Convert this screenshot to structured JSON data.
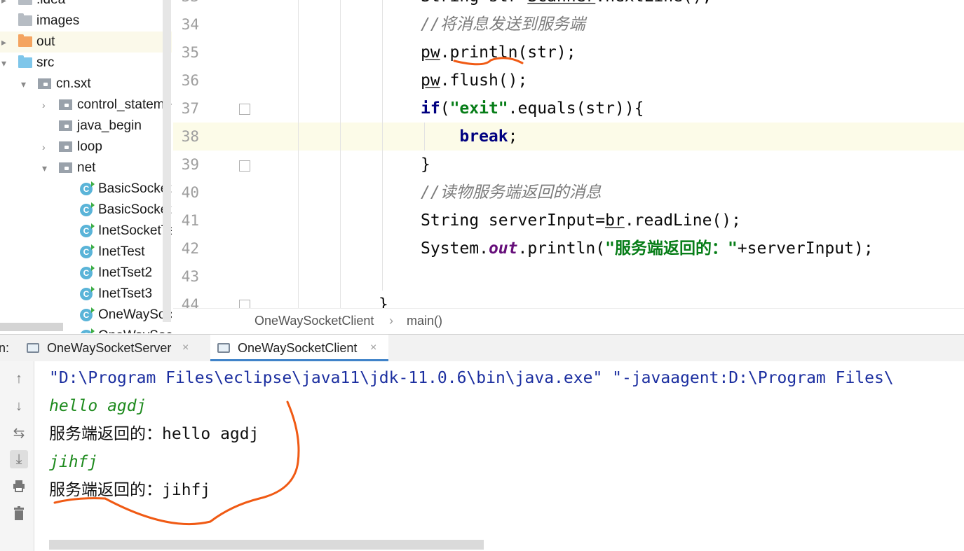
{
  "tree": {
    "items": [
      {
        "label": ".idea",
        "indent": 0,
        "icon": "folder",
        "arrow": "▸"
      },
      {
        "label": "images",
        "indent": 0,
        "icon": "folder",
        "arrow": ""
      },
      {
        "label": "out",
        "indent": 0,
        "icon": "folder-orange",
        "arrow": "▸"
      },
      {
        "label": "src",
        "indent": 0,
        "icon": "folder-blue",
        "arrow": "▾"
      },
      {
        "label": "cn.sxt",
        "indent": 1,
        "icon": "package",
        "arrow": "▾"
      },
      {
        "label": "control_statement",
        "indent": 2,
        "icon": "package",
        "arrow": "›"
      },
      {
        "label": "java_begin",
        "indent": 2,
        "icon": "package",
        "arrow": ""
      },
      {
        "label": "loop",
        "indent": 2,
        "icon": "package",
        "arrow": "›"
      },
      {
        "label": "net",
        "indent": 2,
        "icon": "package",
        "arrow": "▾"
      },
      {
        "label": "BasicSocketClient",
        "indent": 3,
        "icon": "class",
        "arrow": ""
      },
      {
        "label": "BasicSocketServer",
        "indent": 3,
        "icon": "class",
        "arrow": ""
      },
      {
        "label": "InetSocketTest",
        "indent": 3,
        "icon": "class",
        "arrow": ""
      },
      {
        "label": "InetTest",
        "indent": 3,
        "icon": "class",
        "arrow": ""
      },
      {
        "label": "InetTset2",
        "indent": 3,
        "icon": "class",
        "arrow": ""
      },
      {
        "label": "InetTset3",
        "indent": 3,
        "icon": "class",
        "arrow": ""
      },
      {
        "label": "OneWaySocketClient",
        "indent": 3,
        "icon": "class",
        "arrow": ""
      },
      {
        "label": "OneWaySocketServer",
        "indent": 3,
        "icon": "class",
        "arrow": ""
      }
    ]
  },
  "editor": {
    "lines": [
      {
        "num": "33",
        "parts": [
          [
            "plain",
            "String str="
          ],
          [
            "ul",
            "Scanner"
          ],
          [
            "plain",
            ".nextLine();"
          ]
        ]
      },
      {
        "num": "34",
        "parts": [
          [
            "cmt",
            "//将消息发送到服务端"
          ]
        ]
      },
      {
        "num": "35",
        "parts": [
          [
            "ul",
            "pw"
          ],
          [
            "plain",
            ".println(str);"
          ]
        ]
      },
      {
        "num": "36",
        "parts": [
          [
            "ul",
            "pw"
          ],
          [
            "plain",
            ".flush();"
          ]
        ]
      },
      {
        "num": "37",
        "parts": [
          [
            "kw",
            "if"
          ],
          [
            "plain",
            "("
          ],
          [
            "str",
            "\"exit\""
          ],
          [
            "plain",
            ".equals(str)){"
          ]
        ]
      },
      {
        "num": "38",
        "parts": [
          [
            "plain",
            "    "
          ],
          [
            "kw",
            "break"
          ],
          [
            "plain",
            ";"
          ]
        ]
      },
      {
        "num": "39",
        "parts": [
          [
            "plain",
            "}"
          ]
        ]
      },
      {
        "num": "40",
        "parts": [
          [
            "cmt",
            "//读物服务端返回的消息"
          ]
        ]
      },
      {
        "num": "41",
        "parts": [
          [
            "plain",
            "String serverInput="
          ],
          [
            "ul",
            "br"
          ],
          [
            "plain",
            ".readLine();"
          ]
        ]
      },
      {
        "num": "42",
        "parts": [
          [
            "plain",
            "System."
          ],
          [
            "fld",
            "out"
          ],
          [
            "plain",
            ".println("
          ],
          [
            "str",
            "\"服务端返回的：\""
          ],
          [
            "plain",
            "+serverInput);"
          ]
        ]
      },
      {
        "num": "43",
        "parts": []
      },
      {
        "num": "44",
        "parts": [
          [
            "plain",
            "}"
          ]
        ]
      }
    ]
  },
  "breadcrumb": {
    "class_name": "OneWaySocketClient",
    "separator": "›",
    "method": "main()"
  },
  "run": {
    "prefix": "n:",
    "tabs": [
      {
        "label": "OneWaySocketServer",
        "active": false
      },
      {
        "label": "OneWaySocketClient",
        "active": true
      }
    ],
    "close_glyph": "×"
  },
  "console": {
    "lines": [
      {
        "type": "cmd",
        "text": "\"D:\\Program Files\\eclipse\\java11\\jdk-11.0.6\\bin\\java.exe\" \"-javaagent:D:\\Program Files\\"
      },
      {
        "type": "input",
        "text": "hello agdj"
      },
      {
        "type": "output",
        "text": "服务端返回的：hello agdj"
      },
      {
        "type": "input",
        "text": "jihfj"
      },
      {
        "type": "output",
        "text": "服务端返回的：jihfj"
      }
    ],
    "tools": [
      "up-arrow-icon",
      "down-arrow-icon",
      "soft-wrap-icon",
      "scroll-to-end-icon",
      "print-icon",
      "trash-icon"
    ]
  },
  "annotations": {
    "color": "#f05a14"
  }
}
